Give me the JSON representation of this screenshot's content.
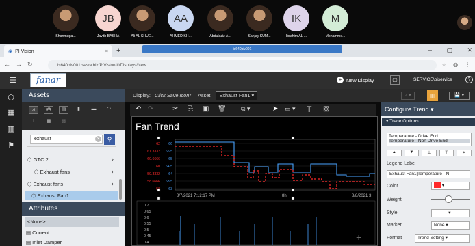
{
  "meeting": {
    "participants": [
      {
        "name": "Shanmuga...",
        "initials": "",
        "photo": true,
        "bg": "#c99a74"
      },
      {
        "name": "Javith BASHA",
        "initials": "JB",
        "photo": false,
        "bg": "#f7d5d0"
      },
      {
        "name": "Ali AL SHUE...",
        "initials": "",
        "photo": true,
        "bg": "#b89a82"
      },
      {
        "name": "AHMED KH...",
        "initials": "AA",
        "photo": false,
        "bg": "#c9d7f1"
      },
      {
        "name": "Abdulaziz A...",
        "initials": "",
        "photo": true,
        "bg": "#8b6c5c"
      },
      {
        "name": "Sanjay KUM...",
        "initials": "",
        "photo": true,
        "bg": "#c6a584"
      },
      {
        "name": "Ibrahim AL ...",
        "initials": "IK",
        "photo": false,
        "bg": "#ded4ea"
      },
      {
        "name": "Mohamme...",
        "initials": "M",
        "photo": false,
        "bg": "#d3ecd6"
      }
    ]
  },
  "browser": {
    "tab_title": "PI Vision",
    "share_title": "is640piv001",
    "url": "is640piv001.sasrv.biz/PIVision/#/Displays/New"
  },
  "app": {
    "logo": "fanar",
    "new_display": "New Display",
    "user": "SERVICE\\piservice"
  },
  "assets": {
    "title": "Assets",
    "search_value": "exhaust",
    "tree": [
      {
        "label": "GTC 2",
        "chev": "›"
      },
      {
        "label": "Exhaust fans",
        "chev": "›"
      },
      {
        "label": "Exhaust fans",
        "chev": "›"
      },
      {
        "label": "Exhaust Fan1",
        "chev": ""
      }
    ]
  },
  "attributes": {
    "title": "Attributes",
    "items": [
      "<None>",
      "Current",
      "Inlet Damper"
    ]
  },
  "display": {
    "label": "Display:",
    "save_hint": "Click Save Icon*",
    "asset_label": "Asset:",
    "asset_value": "Exhaust Fan1"
  },
  "trend": {
    "title": "Fan Trend",
    "left_labels_red": [
      "62",
      "61.3332",
      "60.6666",
      "60",
      "59.3332",
      "58.6666",
      "58"
    ],
    "left_labels_blue": [
      "66",
      "65.5",
      "65",
      "64.5",
      "64",
      "63.5",
      "63"
    ],
    "start_time": "8/7/2021 7:12:17 PM",
    "duration": "8h",
    "end_time": "8/8/2021 3:",
    "lower_labels": [
      "0.7",
      "0.65",
      "0.6",
      "0.55",
      "0.5",
      "0.45",
      "0.4"
    ],
    "colors": {
      "drive": "#4aa3ff",
      "nondrive": "#ff2a2a"
    }
  },
  "configure": {
    "title": "Configure Trend",
    "section": "Trace Options",
    "traces": [
      "Temperature - Drive End",
      "Temperature - Non Drive End"
    ],
    "legend_label": "Legend Label",
    "legend_value": "Exhaust Fan1|Temperature - N",
    "color_label": "Color",
    "weight_label": "Weight",
    "style_label": "Style",
    "style_value": "---------",
    "marker_label": "Marker",
    "marker_value": "None",
    "format_label": "Format",
    "format_value": "Trend Setting"
  }
}
